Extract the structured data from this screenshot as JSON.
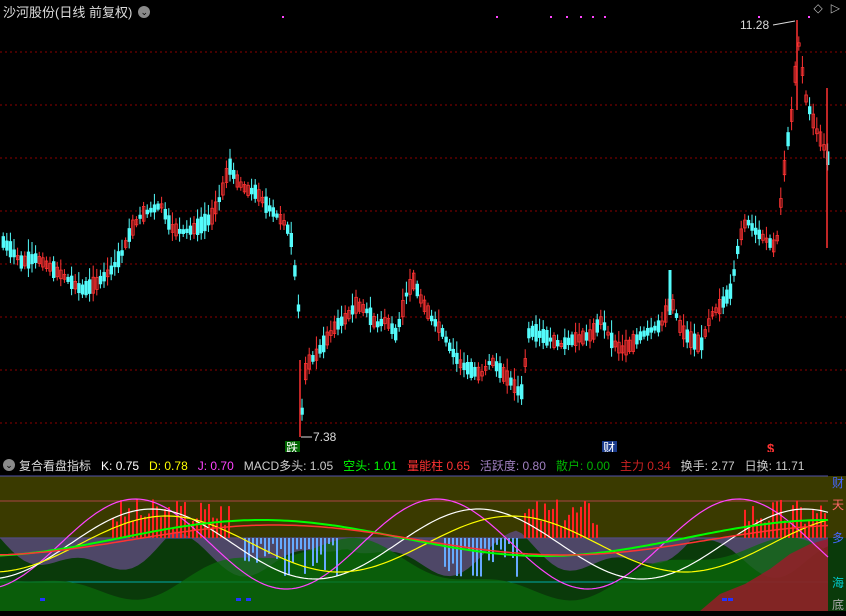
{
  "header": {
    "title": "沙河股份(日线 前复权)",
    "dropdown_icon": "chevron-down-icon"
  },
  "top_right_icons": {
    "diamond": "◇",
    "caret": "▷"
  },
  "price_chart": {
    "high_label": "11.28",
    "low_label": "7.38",
    "markers": {
      "die": "跌",
      "cai": "财",
      "dollar": "$"
    }
  },
  "indicator": {
    "name": "复合看盘指标",
    "items": [
      {
        "label": "K:",
        "value": "0.75",
        "color": "#ffffff"
      },
      {
        "label": "D:",
        "value": "0.78",
        "color": "#ffff00"
      },
      {
        "label": "J:",
        "value": "0.70",
        "color": "#ff44ff"
      },
      {
        "label": "MACD多头:",
        "value": "1.05",
        "color": "#cccccc"
      },
      {
        "label": "空头:",
        "value": "1.01",
        "color": "#00ff00"
      },
      {
        "label": "量能柱",
        "value": "0.65",
        "color": "#ff3333"
      },
      {
        "label": "活跃度:",
        "value": "0.80",
        "color": "#a080c0"
      },
      {
        "label": "散户:",
        "value": "0.00",
        "color": "#00b000"
      },
      {
        "label": "主力",
        "value": "0.34",
        "color": "#cc2222"
      },
      {
        "label": "换手:",
        "value": "2.77",
        "color": "#cccccc"
      },
      {
        "label": "日换:",
        "value": "11.71",
        "color": "#cccccc"
      }
    ]
  },
  "side_labels": {
    "a": "财",
    "b": "天",
    "c": "多",
    "d": "海",
    "e": "底"
  },
  "colors": {
    "up": "#ff3333",
    "down": "#54fcfc",
    "grid": "#8b0000",
    "magenta": "#ff44ff"
  }
}
